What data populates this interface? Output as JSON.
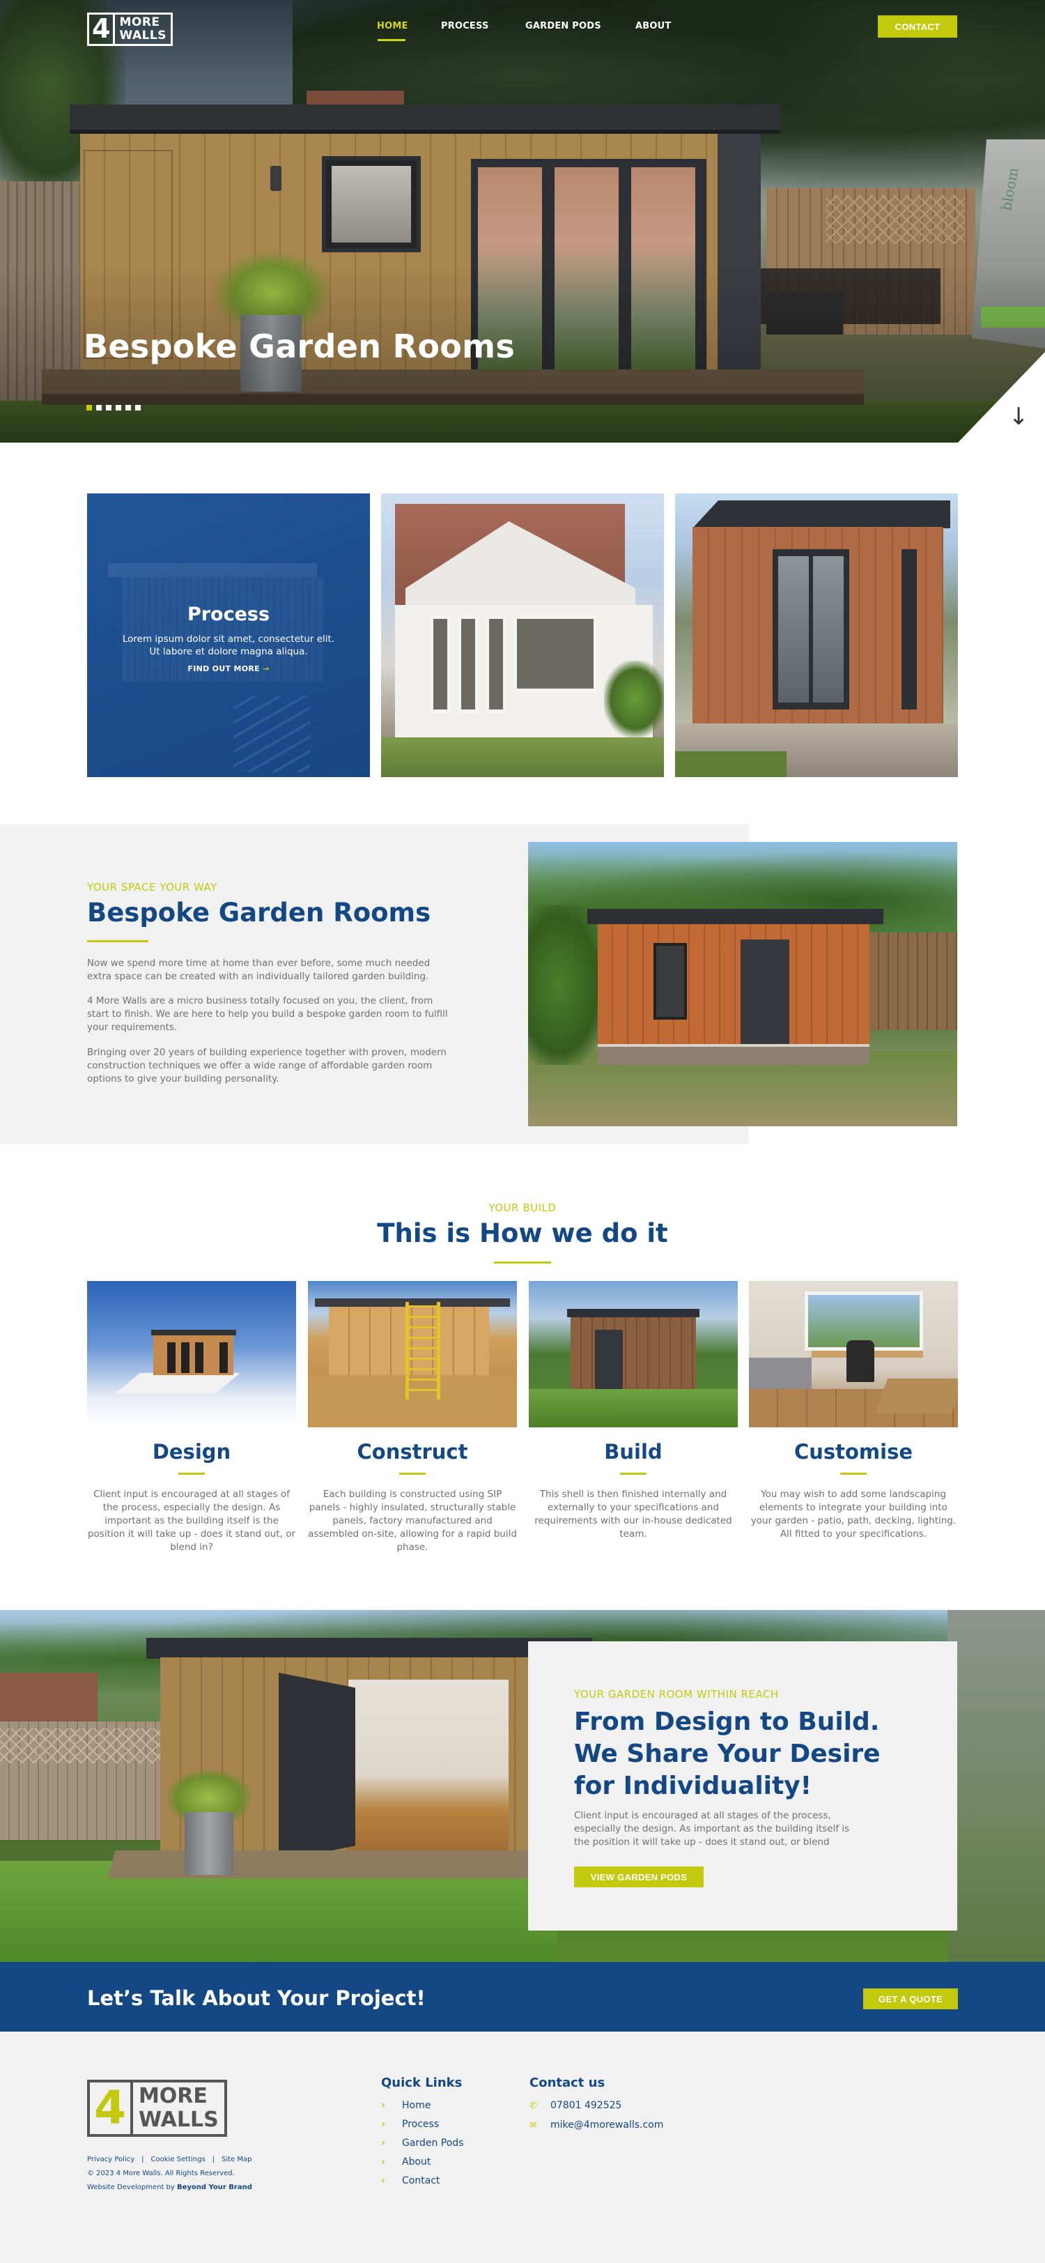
{
  "nav": {
    "logo": {
      "number": "4",
      "word1": "MORE",
      "word2": "WALLS"
    },
    "items": [
      {
        "label": "HOME",
        "active": true
      },
      {
        "label": "PROCESS",
        "active": false
      },
      {
        "label": "GARDEN PODS",
        "active": false
      },
      {
        "label": "ABOUT",
        "active": false
      }
    ],
    "contact_button": "CONTACT"
  },
  "hero": {
    "title": "Bespoke Garden Rooms",
    "slide_count": 6,
    "active_slide": 1,
    "umbrella_text": "bloom",
    "scroll_icon": "arrow-down-icon"
  },
  "cards": {
    "process": {
      "title": "Process",
      "text": "Lorem ipsum dolor sit amet, consectetur elit. Ut labore et dolore magna aliqua.",
      "link": "FIND OUT MORE",
      "link_arrow": "→"
    }
  },
  "bespoke": {
    "eyebrow": "YOUR SPACE YOUR WAY",
    "title": "Bespoke Garden Rooms",
    "paragraphs": [
      "Now we spend more time at home than ever before, some much needed extra space can be created with an individually tailored garden building.",
      "4 More Walls are a micro business totally focused on you, the client, from start to finish. We are here to help you build a bespoke garden room to fulfill your requirements.",
      "Bringing over 20 years of building experience together with proven, modern construction techniques we offer a wide range of affordable garden room options to give your building personality."
    ]
  },
  "how": {
    "eyebrow": "YOUR BUILD",
    "title": "This is How we do it",
    "steps": [
      {
        "title": "Design",
        "text": "Client input is encouraged at all stages of the process, especially the design. As important as the building itself is the position it will take up - does it stand out, or blend in?"
      },
      {
        "title": "Construct",
        "text": "Each building is constructed using SIP panels - highly insulated, structurally stable panels, factory manufactured and assembled on-site, allowing for a rapid build phase."
      },
      {
        "title": "Build",
        "text": "This shell is then finished internally and externally to your specifications and requirements with our in-house dedicated team."
      },
      {
        "title": "Customise",
        "text": "You may wish to add some landscaping elements to integrate your building into your garden - patio, path, decking, lighting. All fitted to your specifications."
      }
    ]
  },
  "design_to_build": {
    "eyebrow": "YOUR GARDEN ROOM WITHIN REACH",
    "title_lines": [
      "From Design to Build.",
      "We Share Your Desire",
      "for Individuality!"
    ],
    "text": "Client input is encouraged at all stages of the process, especially the design. As important as the building itself is the position it will take up - does it stand out, or blend",
    "button": "VIEW GARDEN PODS"
  },
  "cta": {
    "text": "Let’s Talk About Your Project!",
    "button": "GET A QUOTE"
  },
  "footer": {
    "logo": {
      "number": "4",
      "word1": "MORE",
      "word2": "WALLS"
    },
    "legal_links": [
      "Privacy Policy",
      "Cookie Settings",
      "Site Map"
    ],
    "legal_sep": "|",
    "copyright": "© 2023 4 More Walls. All Rights Reserved.",
    "credit_prefix": "Website Development by",
    "credit_brand": "Beyond Your Brand",
    "quick_links_title": "Quick Links",
    "quick_links": [
      "Home",
      "Process",
      "Garden Pods",
      "About",
      "Contact"
    ],
    "contact_title": "Contact us",
    "phone": "07801 492525",
    "email": "mike@4morewalls.com"
  },
  "colors": {
    "lime": "#c3c90c",
    "navy": "#134885",
    "light_bg": "#f1f1f1"
  }
}
